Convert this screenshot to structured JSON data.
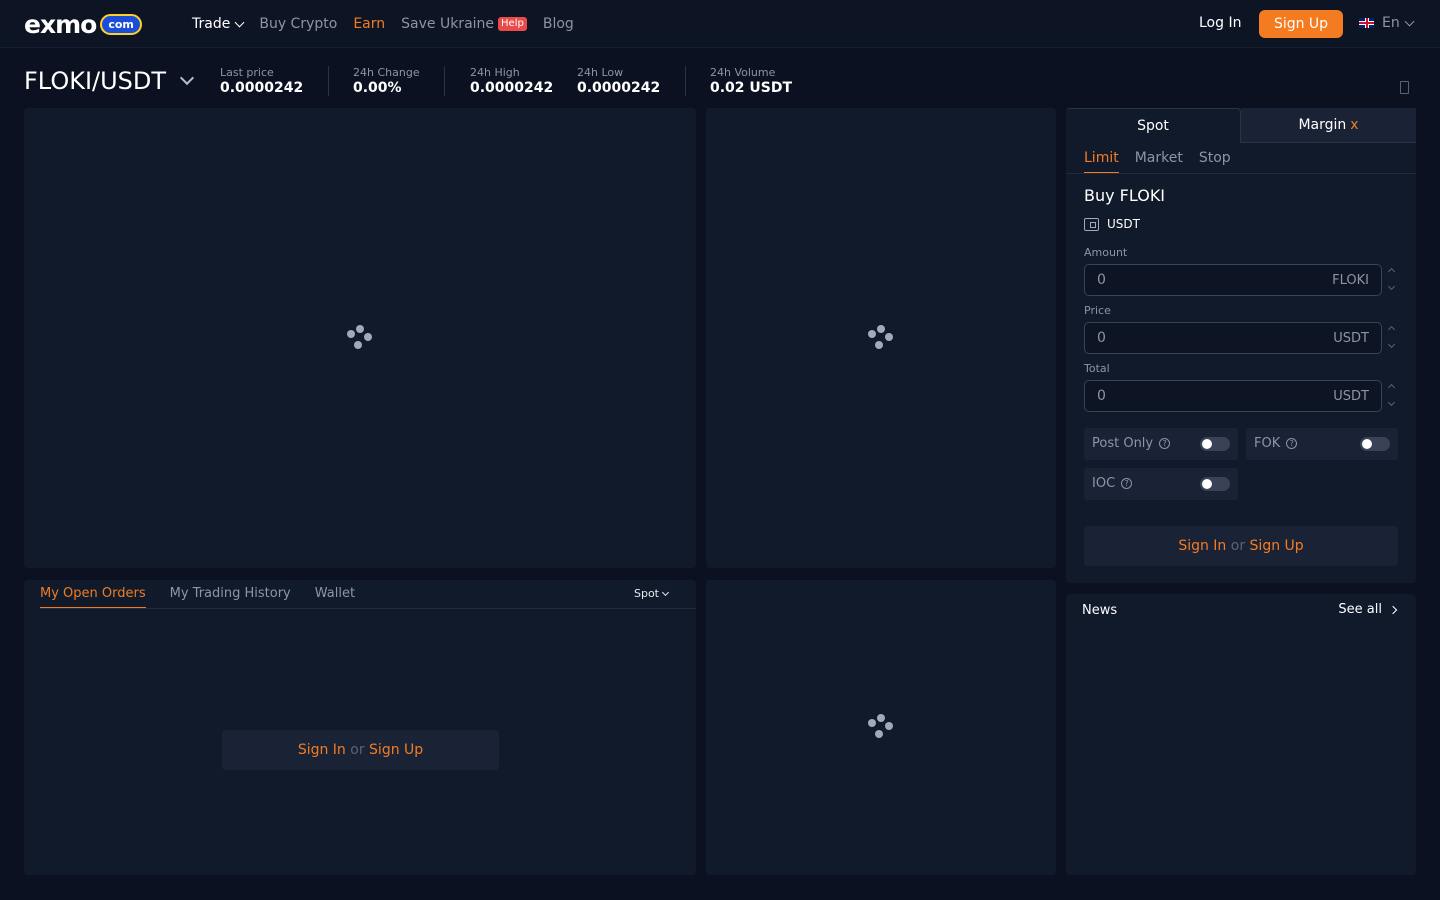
{
  "brand": {
    "logo_word": "exmo",
    "logo_badge": "com"
  },
  "nav": {
    "trade": "Trade",
    "buy_crypto": "Buy Crypto",
    "earn": "Earn",
    "save_ukraine": "Save Ukraine",
    "help_badge": "Help",
    "blog": "Blog",
    "login": "Log In",
    "signup": "Sign Up",
    "language": "En"
  },
  "ticker": {
    "pair": "FLOKI/USDT",
    "last_price_label": "Last price",
    "last_price": "0.0000242",
    "change_label": "24h Change",
    "change": "0.00%",
    "high_label": "24h High",
    "high": "0.0000242",
    "low_label": "24h Low",
    "low": "0.0000242",
    "volume_label": "24h Volume",
    "volume": "0.02 USDT"
  },
  "orders": {
    "tabs": [
      "My Open Orders",
      "My Trading History",
      "Wallet"
    ],
    "market_select": "Spot",
    "sign_in": "Sign In",
    "or": "or",
    "sign_up": "Sign Up"
  },
  "trade_form": {
    "tabs": {
      "spot": "Spot",
      "margin": "Margin",
      "margin_close": "x"
    },
    "order_types": [
      "Limit",
      "Market",
      "Stop"
    ],
    "title": "Buy FLOKI",
    "wallet_currency": "USDT",
    "amount": {
      "label": "Amount",
      "placeholder": "0",
      "unit": "FLOKI"
    },
    "price": {
      "label": "Price",
      "placeholder": "0",
      "unit": "USDT"
    },
    "total": {
      "label": "Total",
      "placeholder": "0",
      "unit": "USDT"
    },
    "options": {
      "post_only": "Post Only",
      "fok": "FOK",
      "ioc": "IOC",
      "help_glyph": "?"
    },
    "sign_in": "Sign In",
    "or": "or",
    "sign_up": "Sign Up"
  },
  "news": {
    "title": "News",
    "see_all": "See all"
  },
  "colors": {
    "accent": "#f47b20",
    "background": "#0b1120",
    "panel": "#111a2b",
    "help_badge": "#ea4a4a"
  }
}
